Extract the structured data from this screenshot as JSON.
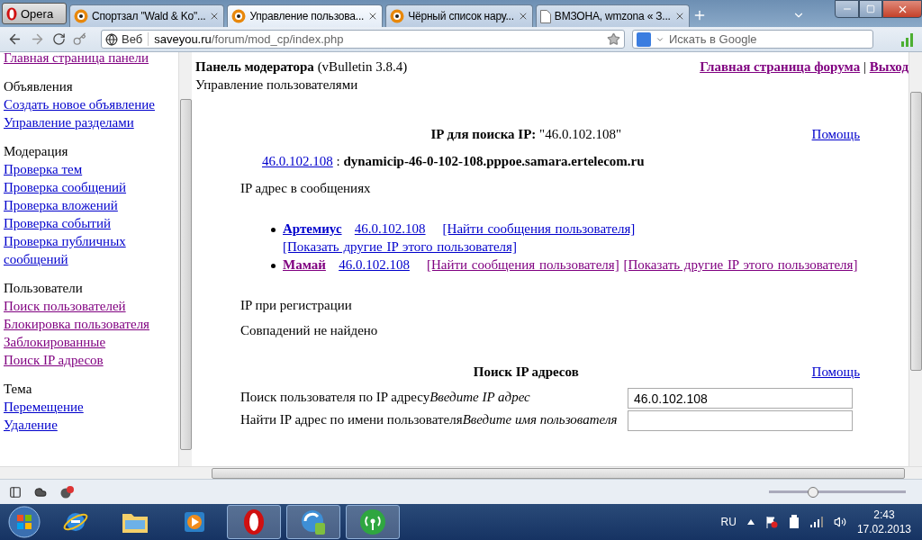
{
  "browser": {
    "menu_label": "Opera",
    "tabs": [
      {
        "label": "Спортзал \"Wald & Ko\"...",
        "kind": "forum",
        "selected": false
      },
      {
        "label": "Управление пользова...",
        "kind": "forum",
        "selected": true
      },
      {
        "label": "Чёрный список нару...",
        "kind": "forum",
        "selected": false
      },
      {
        "label": "ВМЗОНА, wmzona « З...",
        "kind": "page",
        "selected": false
      }
    ],
    "web_badge": "Веб",
    "address_host": "saveyou.ru",
    "address_path": "/forum/mod_cp/index.php",
    "search_placeholder": "Искать в Google"
  },
  "sidebar": {
    "top_link": {
      "label": "Главная страница панели",
      "visited": true
    },
    "groups": [
      {
        "heading": "Объявления",
        "links": [
          {
            "label": "Создать новое объявление",
            "visited": false
          },
          {
            "label": "Управление разделами",
            "visited": false
          }
        ]
      },
      {
        "heading": "Модерация",
        "links": [
          {
            "label": "Проверка тем",
            "visited": false
          },
          {
            "label": "Проверка сообщений",
            "visited": false
          },
          {
            "label": "Проверка вложений",
            "visited": false
          },
          {
            "label": "Проверка событий",
            "visited": false
          },
          {
            "label": "Проверка публичных сообщений",
            "visited": false
          }
        ]
      },
      {
        "heading": "Пользователи",
        "links": [
          {
            "label": "Поиск пользователей",
            "visited": true
          },
          {
            "label": "Блокировка пользователя",
            "visited": true
          },
          {
            "label": "Заблокированные",
            "visited": true
          },
          {
            "label": "Поиск IP адресов",
            "visited": true
          }
        ]
      },
      {
        "heading": "Тема",
        "links": [
          {
            "label": "Перемещение",
            "visited": false
          },
          {
            "label": "Удаление",
            "visited": false
          }
        ]
      }
    ]
  },
  "main": {
    "title": "Панель модератора",
    "version": "(vBulletin 3.8.4)",
    "subtitle": "Управление пользователями",
    "nav_links": [
      {
        "label": "Главная страница форума",
        "visited": true
      },
      {
        "label": "Выход",
        "visited": true
      }
    ],
    "nav_separator": "|",
    "result": {
      "title": "IP для поиска IP:",
      "query": "\"46.0.102.108\"",
      "help": "Помощь",
      "host_ip": "46.0.102.108",
      "host_separator": ":",
      "host_name": "dynamicip-46-0-102-108.pppoe.samara.ertelecom.ru",
      "posts_heading": "IP адрес в сообщениях",
      "users": [
        {
          "name": "Артемиус",
          "ip": "46.0.102.108",
          "find_posts": "[Найти сообщения пользователя]",
          "other_ips": "[Показать другие IP этого пользователя]",
          "visited": false
        },
        {
          "name": "Мамай",
          "ip": "46.0.102.108",
          "find_posts": "[Найти сообщения пользователя]",
          "other_ips": "[Показать другие IP этого пользователя]",
          "visited": true
        }
      ],
      "registration_heading": "IP при регистрации",
      "registration_result": "Совпадений не найдено"
    },
    "search_form": {
      "title": "Поиск IP адресов",
      "help": "Помощь",
      "rows": [
        {
          "label": "Поиск пользователя по IP адресу",
          "hint": "Введите IP адрес",
          "value": "46.0.102.108"
        },
        {
          "label": "Найти IP адрес по имени пользователя",
          "hint": "Введите имя пользователя"
        }
      ]
    }
  },
  "status_bar": {
    "zoom": {
      "level": 0.31
    }
  },
  "taskbar": {
    "apps": [
      {
        "kind": "ie",
        "selected": false
      },
      {
        "kind": "explorer",
        "selected": false
      },
      {
        "kind": "media",
        "selected": false
      },
      {
        "kind": "opera",
        "selected": true
      },
      {
        "kind": "sync",
        "selected": true
      },
      {
        "kind": "wifi",
        "selected": true
      }
    ],
    "language": "RU",
    "time": "2:43",
    "date": "17.02.2013"
  }
}
